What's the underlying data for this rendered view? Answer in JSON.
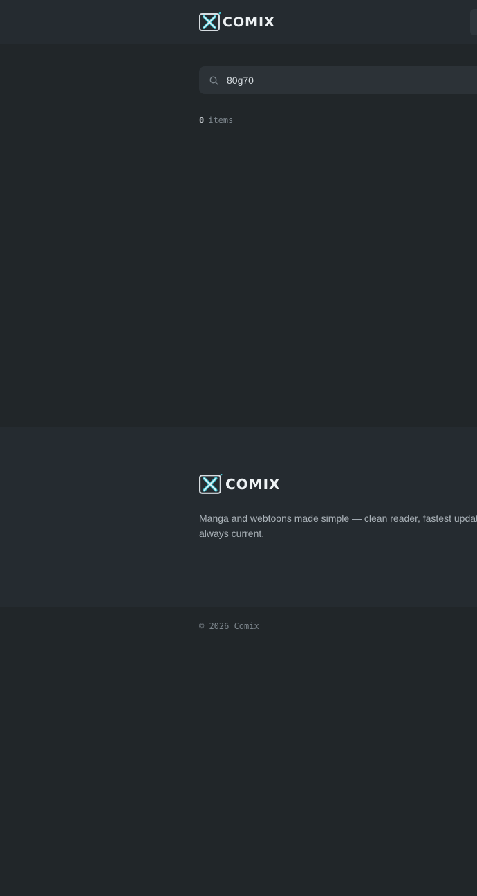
{
  "header": {
    "logo_text": "COMIX"
  },
  "search": {
    "value": "80g70",
    "icon": "search-icon"
  },
  "results": {
    "count": "0",
    "label": "items"
  },
  "footer": {
    "logo_text": "COMIX",
    "tagline_line1": "Manga and webtoons made simple — clean reader, fastest updates,",
    "tagline_line2": "always current.",
    "copyright": "© 2026 Comix"
  },
  "colors": {
    "background": "#212629",
    "surface": "#252b30",
    "input": "#2c3237",
    "accent": "#3fc6d6"
  }
}
